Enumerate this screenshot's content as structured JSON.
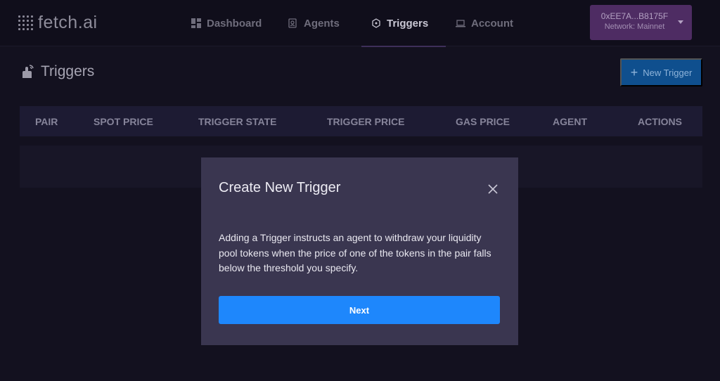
{
  "brand": {
    "name": "fetch.ai"
  },
  "nav": {
    "items": [
      {
        "label": "Dashboard",
        "icon": "grid-icon"
      },
      {
        "label": "Agents",
        "icon": "agent-icon"
      },
      {
        "label": "Triggers",
        "icon": "trigger-icon",
        "active": true
      },
      {
        "label": "Account",
        "icon": "laptop-icon"
      }
    ]
  },
  "wallet": {
    "address": "0xEE7A...B8175F",
    "network": "Network: Mainnet"
  },
  "page": {
    "title": "Triggers",
    "new_button": "New Trigger"
  },
  "table": {
    "columns": [
      "PAIR",
      "SPOT PRICE",
      "TRIGGER STATE",
      "TRIGGER PRICE",
      "GAS PRICE",
      "AGENT",
      "ACTIONS"
    ]
  },
  "modal": {
    "title": "Create New Trigger",
    "body": "Adding a Trigger instructs an agent to withdraw your liquidity pool tokens when the price of one of the tokens in the pair falls below the threshold you specify.",
    "next_label": "Next"
  },
  "colors": {
    "background": "#13111f",
    "modal": "#3a3650",
    "primary": "#1e87fc",
    "wallet": "#4e2c63"
  }
}
